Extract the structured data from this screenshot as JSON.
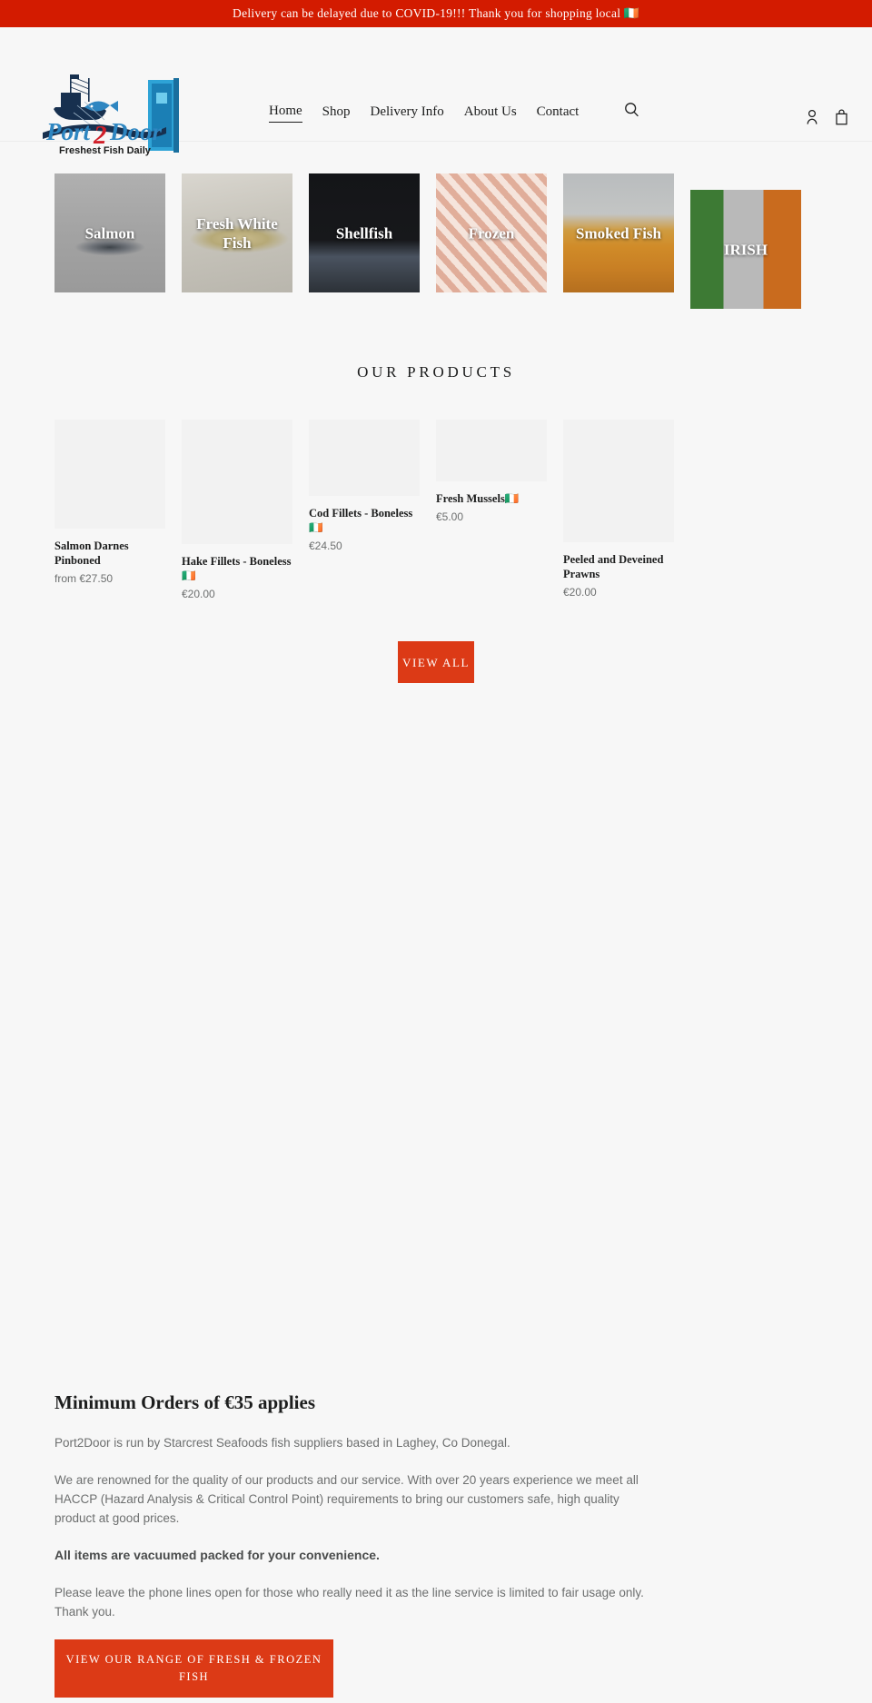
{
  "announcement": {
    "text": "Delivery can be delayed due to COVID-19!!! Thank you for shopping local 🇮🇪"
  },
  "header": {
    "logo_alt": "Port2Door",
    "logo_word_1": "Port",
    "logo_word_2": "2",
    "logo_word_3": "Door",
    "logo_tagline": "Freshest Fish Daily",
    "nav": [
      {
        "label": "Home",
        "active": true
      },
      {
        "label": "Shop",
        "active": false
      },
      {
        "label": "Delivery Info",
        "active": false
      },
      {
        "label": "About Us",
        "active": false
      },
      {
        "label": "Contact",
        "active": false
      }
    ],
    "search_icon": "search-icon",
    "account_icon": "account-icon",
    "cart_icon": "cart-icon"
  },
  "collections": [
    {
      "title": "Salmon",
      "style": "bg-salmon"
    },
    {
      "title": "Fresh White Fish",
      "style": "bg-white-fish"
    },
    {
      "title": "Shellfish",
      "style": "bg-shellfish"
    },
    {
      "title": "Frozen",
      "style": "bg-frozen"
    },
    {
      "title": "Smoked Fish",
      "style": "bg-smoked"
    },
    {
      "title": "IRISH",
      "style": "bg-irish"
    }
  ],
  "products_section": {
    "title": "Our products",
    "view_all_label": "VIEW ALL",
    "items": [
      {
        "name": "Salmon Darnes Pinboned",
        "price": "from €27.50",
        "thumb_height": 120
      },
      {
        "name": "Hake Fillets - Boneless🇮🇪",
        "price": "€20.00",
        "thumb_height": 137
      },
      {
        "name": "Cod Fillets - Boneless🇮🇪",
        "price": "€24.50",
        "thumb_height": 84
      },
      {
        "name": "Fresh Mussels🇮🇪",
        "price": "€5.00",
        "thumb_height": 68
      },
      {
        "name": "Peeled and Deveined Prawns",
        "price": "€20.00",
        "thumb_height": 135
      }
    ]
  },
  "richtext": {
    "heading": "Minimum Orders of €35 applies",
    "paragraph_1": "Port2Door is run by Starcrest Seafoods fish suppliers based in Laghey, Co Donegal.",
    "paragraph_2": "We are renowned for the quality of our products and our service. With over 20 years experience we meet all HACCP (Hazard Analysis & Critical Control Point) requirements to bring our customers safe, high quality product at good prices.",
    "paragraph_3": "All items are vacuumed packed for your convenience.",
    "paragraph_4": "Please leave the phone lines open for those who really need it as the line service is limited to fair usage only. Thank you.",
    "button_label": "VIEW OUR RANGE OF FRESH & FROZEN FISH"
  },
  "colors": {
    "announcement_bg": "#d31b00",
    "accent": "#dc3a16",
    "page_bg": "#f7f7f7",
    "text": "#1c1d1d",
    "muted_text": "#6d6f6f",
    "thumb_placeholder": "#f2f2f2"
  }
}
